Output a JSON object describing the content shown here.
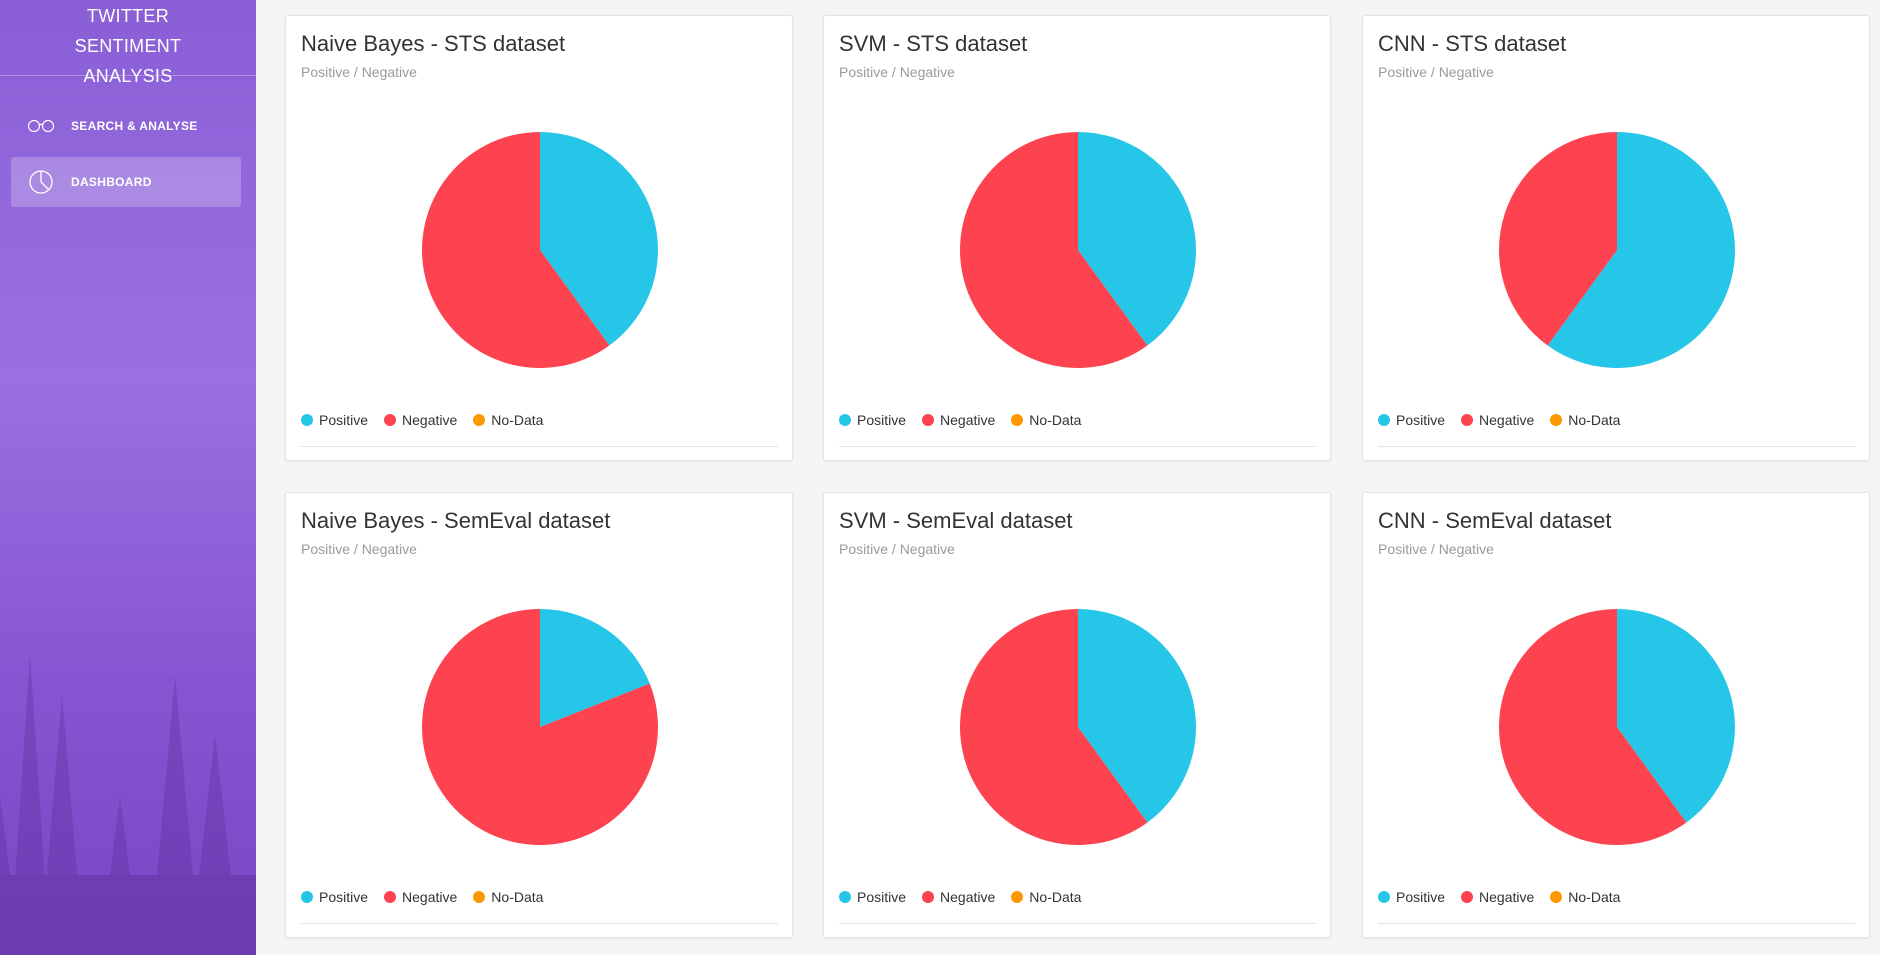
{
  "sidebar": {
    "title": "TWITTER SENTIMENT ANALYSIS",
    "items": [
      {
        "label": "SEARCH & ANALYSE",
        "icon": "glasses-icon",
        "active": false
      },
      {
        "label": "DASHBOARD",
        "icon": "pie-chart-icon",
        "active": true
      }
    ]
  },
  "legend": {
    "positive": "Positive",
    "negative": "Negative",
    "nodata": "No-Data"
  },
  "colors": {
    "positive": "#26c6e8",
    "negative": "#fc434f",
    "nodata": "#ff9800",
    "sidebar": "#8a5fd6"
  },
  "cards": [
    {
      "title": "Naive Bayes - STS dataset",
      "subtitle": "Positive / Negative"
    },
    {
      "title": "SVM - STS dataset",
      "subtitle": "Positive / Negative"
    },
    {
      "title": "CNN - STS dataset",
      "subtitle": "Positive / Negative"
    },
    {
      "title": "Naive Bayes - SemEval dataset",
      "subtitle": "Positive / Negative"
    },
    {
      "title": "SVM - SemEval dataset",
      "subtitle": "Positive / Negative"
    },
    {
      "title": "CNN - SemEval dataset",
      "subtitle": "Positive / Negative"
    }
  ],
  "chart_data": [
    {
      "type": "pie",
      "title": "Naive Bayes - STS dataset",
      "subtitle": "Positive / Negative",
      "categories": [
        "Positive",
        "Negative",
        "No-Data"
      ],
      "values": [
        40,
        60,
        0
      ]
    },
    {
      "type": "pie",
      "title": "SVM - STS dataset",
      "subtitle": "Positive / Negative",
      "categories": [
        "Positive",
        "Negative",
        "No-Data"
      ],
      "values": [
        40,
        60,
        0
      ]
    },
    {
      "type": "pie",
      "title": "CNN - STS dataset",
      "subtitle": "Positive / Negative",
      "categories": [
        "Positive",
        "Negative",
        "No-Data"
      ],
      "values": [
        60,
        40,
        0
      ]
    },
    {
      "type": "pie",
      "title": "Naive Bayes - SemEval dataset",
      "subtitle": "Positive / Negative",
      "categories": [
        "Positive",
        "Negative",
        "No-Data"
      ],
      "values": [
        19,
        81,
        0
      ]
    },
    {
      "type": "pie",
      "title": "SVM - SemEval dataset",
      "subtitle": "Positive / Negative",
      "categories": [
        "Positive",
        "Negative",
        "No-Data"
      ],
      "values": [
        40,
        60,
        0
      ]
    },
    {
      "type": "pie",
      "title": "CNN - SemEval dataset",
      "subtitle": "Positive / Negative",
      "categories": [
        "Positive",
        "Negative",
        "No-Data"
      ],
      "values": [
        40,
        60,
        0
      ]
    }
  ]
}
